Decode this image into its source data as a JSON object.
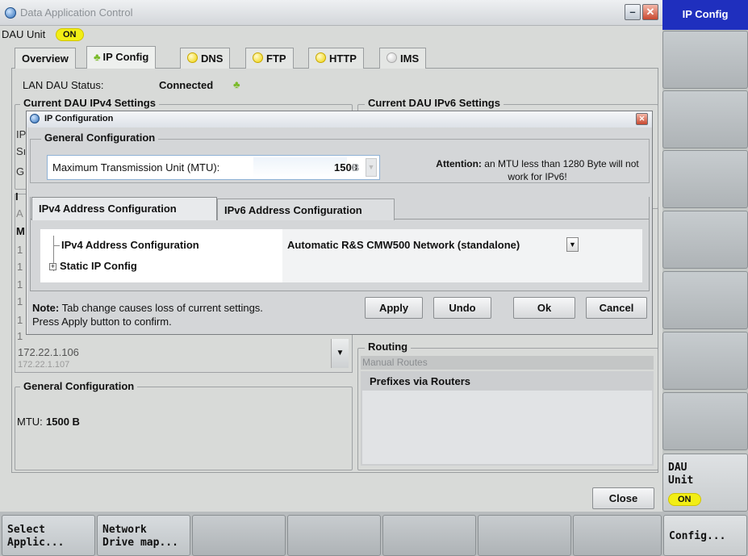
{
  "window": {
    "title": "Data Application Control",
    "unit_label": "DAU Unit",
    "unit_state": "ON"
  },
  "tabs": [
    {
      "label": "Overview",
      "indicator": "none"
    },
    {
      "label": "IP Config",
      "indicator": "connected-icon"
    },
    {
      "label": "DNS",
      "indicator": "yellow"
    },
    {
      "label": "FTP",
      "indicator": "yellow"
    },
    {
      "label": "HTTP",
      "indicator": "yellow"
    },
    {
      "label": "IMS",
      "indicator": "gray"
    }
  ],
  "status": {
    "label": "LAN DAU Status:",
    "value": "Connected"
  },
  "ipv4_settings": {
    "title": "Current DAU IPv4 Settings",
    "row_initials": [
      "IP",
      "Sı",
      "G"
    ]
  },
  "ipv6_settings": {
    "title": "Current DAU IPv6 Settings"
  },
  "address_list": {
    "items": [
      "172.22.1.106",
      "172.22.1.107"
    ],
    "left_initials": [
      "I",
      "A",
      "M",
      "1",
      "1",
      "1",
      "1",
      "1",
      "1"
    ]
  },
  "routing": {
    "title": "Routing",
    "manual_routes": "Manual Routes",
    "prefixes": "Prefixes via Routers"
  },
  "general_configuration": {
    "title": "General Configuration",
    "mtu_label": "MTU:",
    "mtu_value": "1500 B"
  },
  "close_label": "Close",
  "dialog": {
    "title": "IP Configuration",
    "general_title": "General Configuration",
    "mtu_label": "Maximum Transmission Unit (MTU):",
    "mtu_value": "1500",
    "mtu_unit": "B",
    "attention_bold": "Attention:",
    "attention_text": "an MTU less than 1280 Byte will not work for IPv6!",
    "tabs": [
      "IPv4 Address Configuration",
      "IPv6 Address Configuration"
    ],
    "tree": {
      "ipv4_label": "IPv4 Address Configuration",
      "static_label": "Static IP Config"
    },
    "ipv4_mode": "Automatic R&S CMW500 Network (standalone)",
    "note_bold": "Note:",
    "note_line1": "Tab change causes loss of current settings.",
    "note_line2": "Press Apply button to confirm.",
    "buttons": {
      "apply": "Apply",
      "undo": "Undo",
      "ok": "Ok",
      "cancel": "Cancel"
    }
  },
  "right_keys": {
    "top": "IP Config",
    "dau_line1": "DAU",
    "dau_line2": "Unit",
    "dau_state": "ON",
    "config": "Config..."
  },
  "bottom_keys": {
    "select": [
      "Select",
      "Applic..."
    ],
    "network": [
      "Network",
      "Drive map..."
    ]
  }
}
